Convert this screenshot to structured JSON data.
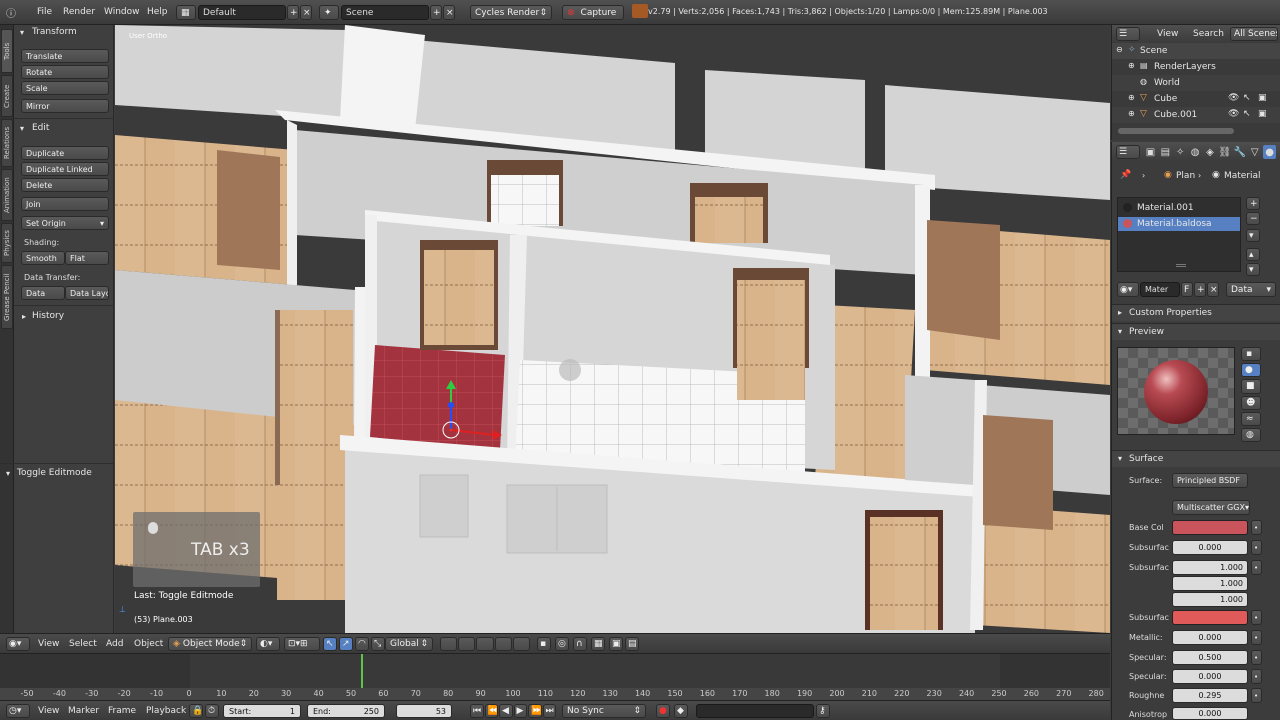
{
  "menu": {
    "file": "File",
    "render": "Render",
    "window": "Window",
    "help": "Help"
  },
  "layout_field": "Default",
  "scene_field": "Scene",
  "render_engine": "Cycles Render",
  "capture_label": "Capture",
  "stats": "v2.79 | Verts:2,056 | Faces:1,743 | Tris:3,862 | Objects:1/20 | Lamps:0/0 | Mem:125.89M | Plane.003",
  "tabs": [
    "Tools",
    "Create",
    "Relations",
    "Animation",
    "Physics",
    "Grease Pencil"
  ],
  "shelf": {
    "transform_title": "Transform",
    "translate": "Translate",
    "rotate": "Rotate",
    "scale": "Scale",
    "mirror": "Mirror",
    "edit_title": "Edit",
    "duplicate": "Duplicate",
    "duplicate_linked": "Duplicate Linked",
    "delete": "Delete",
    "join": "Join",
    "set_origin": "Set Origin",
    "shading_label": "Shading:",
    "smooth": "Smooth",
    "flat": "Flat",
    "data_transfer_label": "Data Transfer:",
    "data": "Data",
    "data_layout": "Data Layo",
    "history": "History",
    "toggle_editmode": "Toggle Editmode"
  },
  "viewport": {
    "view_label": "User Ortho",
    "key_overlay": "TAB x3",
    "last_op": "Last: Toggle Editmode",
    "object_name": "(53) Plane.003"
  },
  "outliner": {
    "view": "View",
    "search": "Search",
    "all_scenes": "All Scenes",
    "items": [
      "Scene",
      "RenderLayers",
      "World",
      "Cube",
      "Cube.001"
    ]
  },
  "props": {
    "breadcrumb_obj": "Plan",
    "breadcrumb_mat": "Material",
    "materials": [
      "Material.001",
      "Material.baldosa"
    ],
    "mat_field": "Mater",
    "mat_f": "F",
    "data_select": "Data",
    "custom_props": "Custom Properties",
    "preview": "Preview",
    "surface_panel": "Surface",
    "surface_label": "Surface:",
    "surface_value": "Principled BSDF",
    "distribution": "Multiscatter GGX",
    "base_color_label": "Base Col",
    "base_color": "#c9545b",
    "subsurface_label": "Subsurfac",
    "subsurface_value": "0.000",
    "subsurface_radius_label": "Subsurfac",
    "radius_values": [
      "1.000",
      "1.000",
      "1.000"
    ],
    "subsurface_color_label": "Subsurfac",
    "subsurface_color": "#e05a5a",
    "metallic_label": "Metallic:",
    "metallic_value": "0.000",
    "specular_label": "Specular:",
    "specular_value": "0.500",
    "specular_tint_label": "Specular:",
    "specular_tint_value": "0.000",
    "roughness_label": "Roughne",
    "roughness_value": "0.295",
    "anisotropic_label": "Anisotrop",
    "anisotropic_value": "0.000"
  },
  "vpheader": {
    "view": "View",
    "select": "Select",
    "add": "Add",
    "object": "Object",
    "mode": "Object Mode",
    "orientation": "Global"
  },
  "timeline": {
    "ticks": [
      "-50",
      "-40",
      "-30",
      "-20",
      "-10",
      "0",
      "10",
      "20",
      "30",
      "40",
      "50",
      "60",
      "70",
      "80",
      "90",
      "100",
      "110",
      "120",
      "130",
      "140",
      "150",
      "160",
      "170",
      "180",
      "190",
      "200",
      "210",
      "220",
      "230",
      "240",
      "250",
      "260",
      "270",
      "280"
    ],
    "current_frame": 53
  },
  "tlheader": {
    "view": "View",
    "marker": "Marker",
    "frame": "Frame",
    "playback": "Playback",
    "start_label": "Start:",
    "start_value": "1",
    "end_label": "End:",
    "end_value": "250",
    "current": "53",
    "sync": "No Sync"
  }
}
